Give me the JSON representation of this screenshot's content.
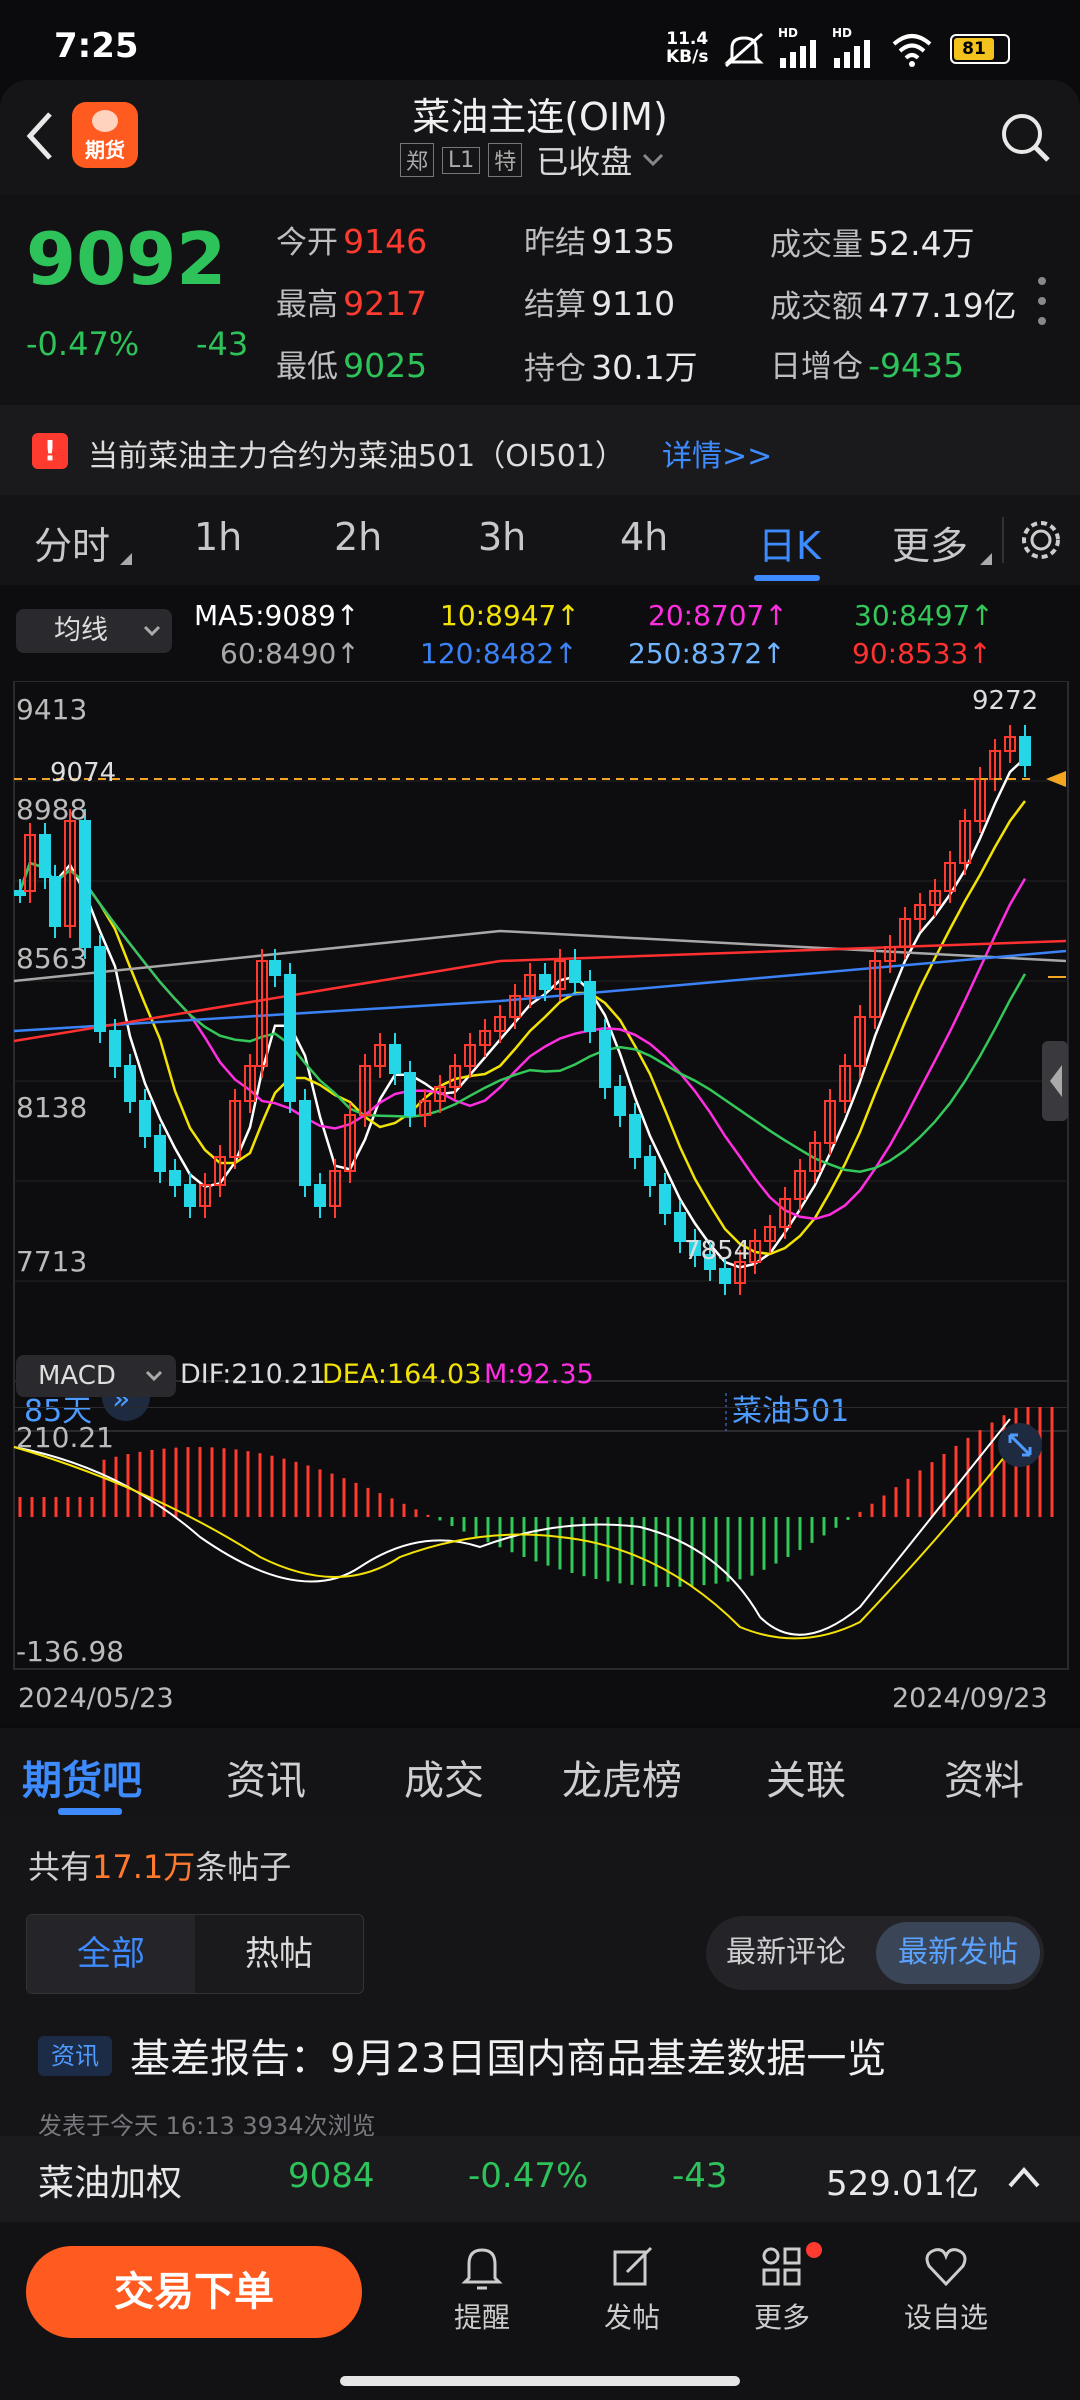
{
  "status": {
    "time": "7:25",
    "net_speed_value": "11.4",
    "net_speed_unit": "KB/s",
    "battery": "81",
    "hd1": "HD",
    "hd2": "HD"
  },
  "header": {
    "logo_text": "期货",
    "title": "菜油主连(OIM)",
    "tag1": "郑",
    "tag2": "L1",
    "tag3": "特",
    "status": "已收盘"
  },
  "quote": {
    "last_price": "9092",
    "change_pct": "-0.47%",
    "change": "-43",
    "open_label": "今开",
    "open": "9146",
    "high_label": "最高",
    "high": "9217",
    "low_label": "最低",
    "low": "9025",
    "prev_label": "昨结",
    "prev": "9135",
    "settle_label": "结算",
    "settle": "9110",
    "oi_label": "持仓",
    "oi": "30.1万",
    "vol_label": "成交量",
    "vol": "52.4万",
    "amount_label": "成交额",
    "amount": "477.19亿",
    "oi_change_label": "日增仓",
    "oi_change": "-9435"
  },
  "notice": {
    "icon": "!",
    "text": "当前菜油主力合约为菜油501（OI501）",
    "link": "详情>>"
  },
  "period_tabs": [
    "分时",
    "1h",
    "2h",
    "3h",
    "4h",
    "日K",
    "更多"
  ],
  "active_period": "日K",
  "indicators": {
    "ma_selector": "均线",
    "ma5": "MA5:9089↑",
    "ma10": "10:8947↑",
    "ma20": "20:8707↑",
    "ma30": "30:8497↑",
    "ma60": "60:8490↑",
    "ma120": "120:8482↑",
    "ma250": "250:8372↑",
    "ma90": "90:8533↑",
    "macd_selector": "MACD",
    "dif": "DIF:210.21",
    "dea": "DEA:164.03",
    "m": "M:92.35"
  },
  "colors": {
    "up": "#ff3b30",
    "down": "#25d7e6",
    "ma5": "#ffffff",
    "ma10": "#f2e205",
    "ma20": "#ff2ee0",
    "ma30": "#34c759",
    "ma60": "#a8a8a8",
    "ma120": "#3b82f6",
    "ma90": "#ff3030",
    "accent": "#ff5a1f"
  },
  "chart_data": {
    "type": "candlestick",
    "price_ticks": [
      "9413",
      "8988",
      "8563",
      "8138",
      "7713"
    ],
    "ylim": [
      7713,
      9413
    ],
    "high_marker": "9272",
    "low_marker": "7854",
    "left_marker": "9074",
    "days_label": "85天",
    "contract_label": "菜油501",
    "macd_top": "210.21",
    "macd_bottom": "-136.98",
    "date_start": "2024/05/23",
    "date_end": "2024/09/23"
  },
  "lower_tabs": [
    "期货吧",
    "资讯",
    "成交",
    "龙虎榜",
    "关联",
    "资料"
  ],
  "active_lower_tab": "期货吧",
  "feed": {
    "count_prefix": "共有",
    "count_value": "17.1万",
    "count_suffix": "条帖子",
    "filter_all": "全部",
    "filter_hot": "热帖",
    "sort_comment": "最新评论",
    "sort_post": "最新发帖",
    "post_tag": "资讯",
    "post_title": "基差报告：9月23日国内商品基差数据一览",
    "post_meta": "发表于今天 16:13   3934次浏览"
  },
  "bottom_ticker": {
    "name": "菜油加权",
    "price": "9084",
    "change_pct": "-0.47%",
    "change": "-43",
    "amount": "529.01亿"
  },
  "bottom_nav": {
    "trade_button": "交易下单",
    "items": [
      "提醒",
      "发帖",
      "更多",
      "设自选"
    ]
  }
}
